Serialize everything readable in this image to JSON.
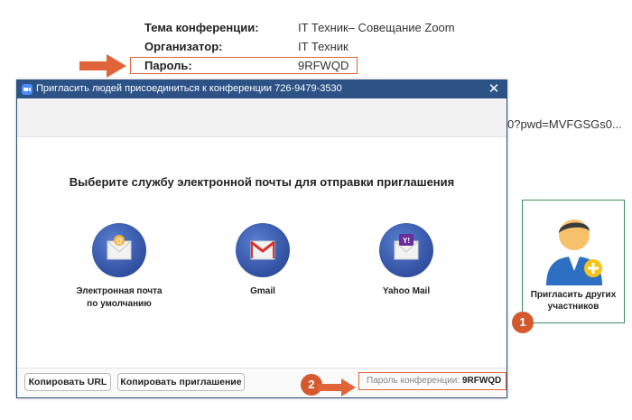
{
  "meeting": {
    "topic_label": "Тема конференции:",
    "topic_value": "IT Техник– Совещание Zoom",
    "host_label": "Организатор:",
    "host_value": "IT Техник",
    "password_label": "Пароль:",
    "password_value": "9RFWQD",
    "url_fragment": "0?pwd=MVFGSGs0..."
  },
  "dialog": {
    "title": "Пригласить людей присоединиться к конференции 726-9479-3530",
    "close_symbol": "✕",
    "heading": "Выберите службу электронной почты для отправки приглашения",
    "services": [
      {
        "label_line1": "Электронная почта",
        "label_line2": "по умолчанию",
        "icon": "default-email-icon"
      },
      {
        "label_line1": "Gmail",
        "label_line2": "",
        "icon": "gmail-icon"
      },
      {
        "label_line1": "Yahoo Mail",
        "label_line2": "",
        "icon": "yahoo-mail-icon"
      }
    ],
    "copy_url_label": "Копировать URL",
    "copy_invite_label": "Копировать приглашение",
    "footer_password_label": "Пароль конференции:",
    "footer_password_value": "9RFWQD"
  },
  "invite_card": {
    "label_line1": "Пригласить других",
    "label_line2": "участников",
    "icon": "add-participant-icon"
  },
  "annotations": {
    "badge1": "1",
    "badge2": "2",
    "accent_color": "#e0643a"
  }
}
